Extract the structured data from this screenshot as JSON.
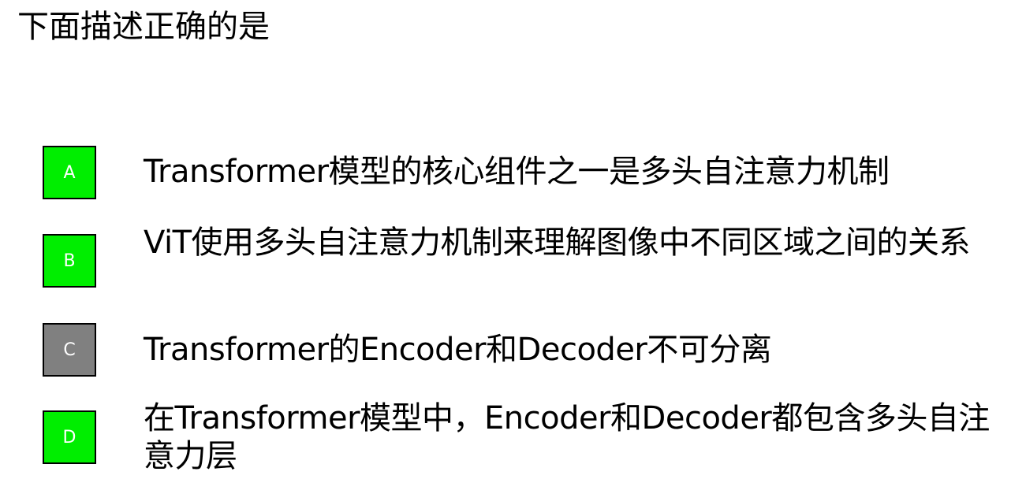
{
  "question": "下面描述正确的是",
  "colors": {
    "selected": "#00ee00",
    "unselected": "#808080",
    "border": "#000000",
    "letter": "#ffffff"
  },
  "options": [
    {
      "letter": "A",
      "text": "Transformer模型的核心组件之一是多头自注意力机制",
      "selected": true
    },
    {
      "letter": "B",
      "text": "ViT使用多头自注意力机制来理解图像中不同区域之间的关系",
      "selected": true
    },
    {
      "letter": "C",
      "text": "Transformer的Encoder和Decoder不可分离",
      "selected": false
    },
    {
      "letter": "D",
      "text": "在Transformer模型中，Encoder和Decoder都包含多头自注意力层",
      "selected": true
    }
  ]
}
